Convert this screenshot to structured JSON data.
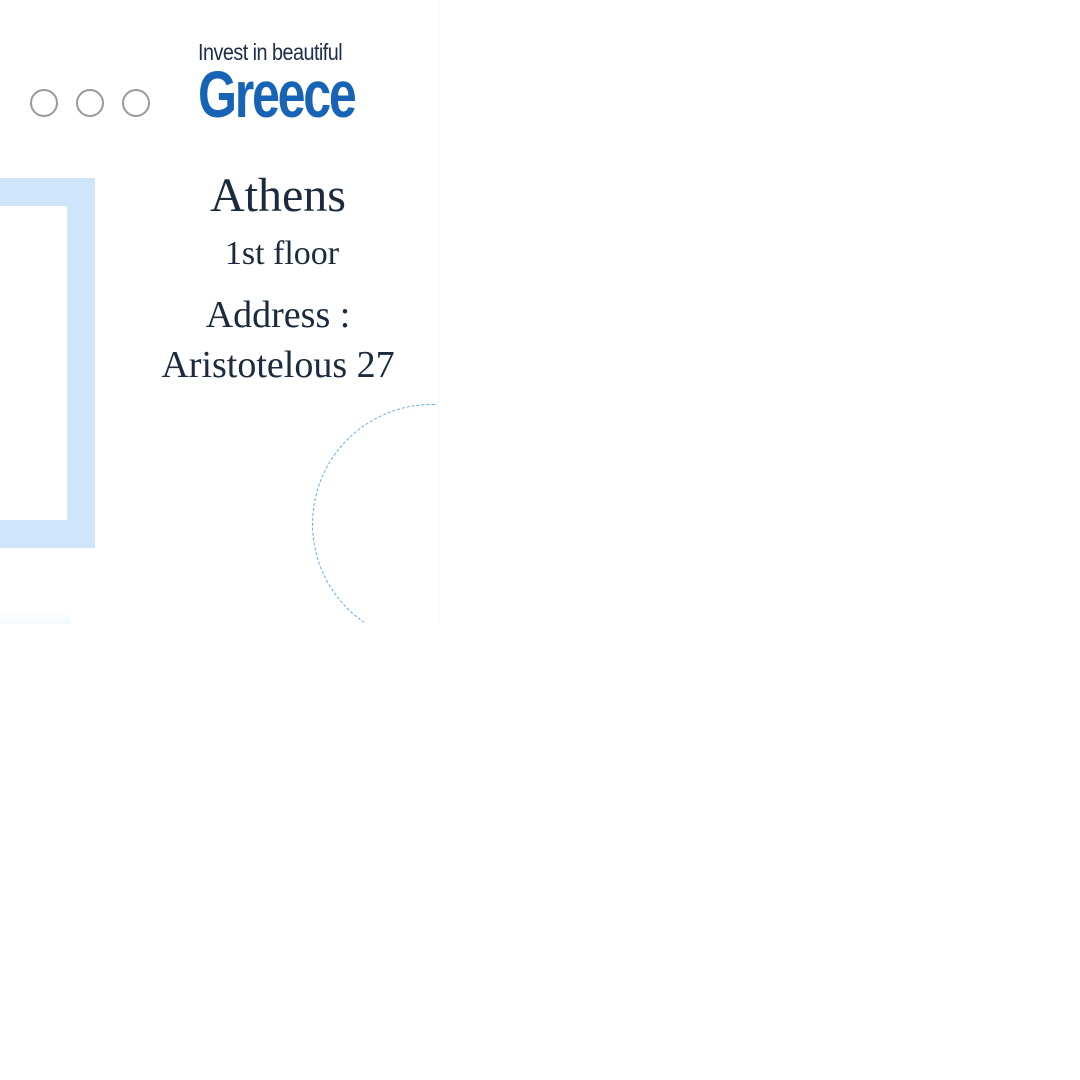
{
  "logo": {
    "tagline": "Invest in beautiful",
    "word": "Greece"
  },
  "carousel": {
    "dot_count": 3
  },
  "location": {
    "city": "Athens",
    "floor": "1st floor",
    "address_label": "Address :",
    "address_value": "Aristotelous 27"
  },
  "colors": {
    "brand_blue": "#1764b6",
    "frame_blue": "#cfe5fc",
    "text_dark": "#1c2a3e"
  }
}
